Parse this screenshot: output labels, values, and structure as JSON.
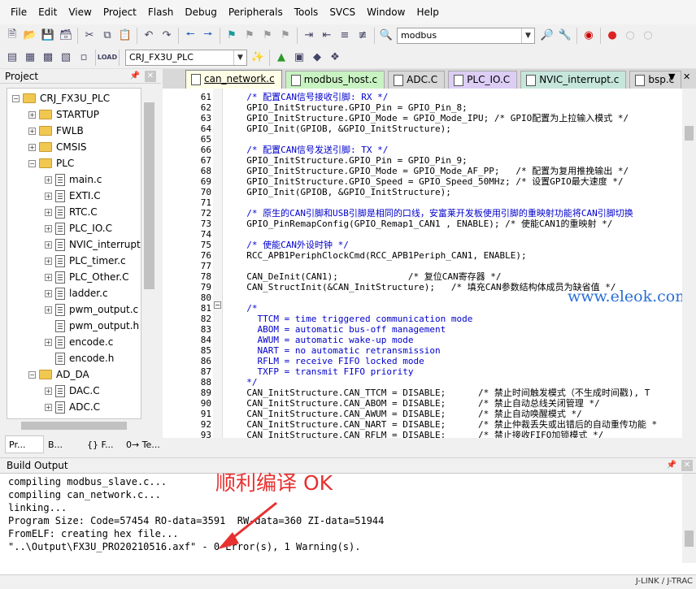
{
  "menu": [
    "File",
    "Edit",
    "View",
    "Project",
    "Flash",
    "Debug",
    "Peripherals",
    "Tools",
    "SVCS",
    "Window",
    "Help"
  ],
  "toolbar": {
    "find_value": "modbus",
    "target_value": "CRJ_FX3U_PLC"
  },
  "project": {
    "title": "Project",
    "tree": [
      {
        "label": "CRJ_FX3U_PLC",
        "type": "root",
        "level": 0,
        "expander": "minus"
      },
      {
        "label": "STARTUP",
        "type": "folder",
        "level": 1,
        "expander": "plus"
      },
      {
        "label": "FWLB",
        "type": "folder",
        "level": 1,
        "expander": "plus"
      },
      {
        "label": "CMSIS",
        "type": "folder",
        "level": 1,
        "expander": "plus"
      },
      {
        "label": "PLC",
        "type": "folder",
        "level": 1,
        "expander": "minus"
      },
      {
        "label": "main.c",
        "type": "file",
        "level": 2,
        "expander": "plus"
      },
      {
        "label": "EXTI.C",
        "type": "file",
        "level": 2,
        "expander": "plus"
      },
      {
        "label": "RTC.C",
        "type": "file",
        "level": 2,
        "expander": "plus"
      },
      {
        "label": "PLC_IO.C",
        "type": "file",
        "level": 2,
        "expander": "plus"
      },
      {
        "label": "NVIC_interrupt",
        "type": "file",
        "level": 2,
        "expander": "plus"
      },
      {
        "label": "PLC_timer.c",
        "type": "file",
        "level": 2,
        "expander": "plus"
      },
      {
        "label": "PLC_Other.C",
        "type": "file",
        "level": 2,
        "expander": "plus"
      },
      {
        "label": "ladder.c",
        "type": "file",
        "level": 2,
        "expander": "plus"
      },
      {
        "label": "pwm_output.c",
        "type": "file",
        "level": 2,
        "expander": "plus"
      },
      {
        "label": "pwm_output.h",
        "type": "file",
        "level": 2,
        "expander": "none"
      },
      {
        "label": "encode.c",
        "type": "file",
        "level": 2,
        "expander": "plus"
      },
      {
        "label": "encode.h",
        "type": "file",
        "level": 2,
        "expander": "none"
      },
      {
        "label": "AD_DA",
        "type": "folder",
        "level": 1,
        "expander": "minus"
      },
      {
        "label": "DAC.C",
        "type": "file",
        "level": 2,
        "expander": "plus"
      },
      {
        "label": "ADC.C",
        "type": "file",
        "level": 2,
        "expander": "plus"
      }
    ],
    "tabs": [
      "Pr...",
      "B...",
      "{} F...",
      "0→ Te..."
    ]
  },
  "editor": {
    "tabs": [
      {
        "label": "can_network.c",
        "color": "#ffffe8",
        "active": true
      },
      {
        "label": "modbus_host.c",
        "color": "#c9f2c3",
        "active": false
      },
      {
        "label": "ADC.C",
        "color": "#d8d8d8",
        "active": false
      },
      {
        "label": "PLC_IO.C",
        "color": "#dccdf5",
        "active": false
      },
      {
        "label": "NVIC_interrupt.c",
        "color": "#c6e6dc",
        "active": false
      },
      {
        "label": "bsp.c",
        "color": "#d8d8d8",
        "active": false
      }
    ],
    "lines": [
      {
        "n": "61",
        "t": "  /* 配置CAN信号接收引脚: RX */",
        "c": true
      },
      {
        "n": "62",
        "t": "  GPIO_InitStructure.GPIO_Pin = GPIO_Pin_8;",
        "c": false
      },
      {
        "n": "63",
        "t": "  GPIO_InitStructure.GPIO_Mode = GPIO_Mode_IPU; /* GPIO配置为上拉输入模式 */",
        "c": false
      },
      {
        "n": "64",
        "t": "  GPIO_Init(GPIOB, &GPIO_InitStructure);",
        "c": false
      },
      {
        "n": "65",
        "t": "",
        "c": false
      },
      {
        "n": "66",
        "t": "  /* 配置CAN信号发送引脚: TX */",
        "c": true
      },
      {
        "n": "67",
        "t": "  GPIO_InitStructure.GPIO_Pin = GPIO_Pin_9;",
        "c": false
      },
      {
        "n": "68",
        "t": "  GPIO_InitStructure.GPIO_Mode = GPIO_Mode_AF_PP;   /* 配置为复用推挽输出 */",
        "c": false
      },
      {
        "n": "69",
        "t": "  GPIO_InitStructure.GPIO_Speed = GPIO_Speed_50MHz; /* 设置GPIO最大速度 */",
        "c": false
      },
      {
        "n": "70",
        "t": "  GPIO_Init(GPIOB, &GPIO_InitStructure);",
        "c": false
      },
      {
        "n": "71",
        "t": "",
        "c": false
      },
      {
        "n": "72",
        "t": "  /* 原生的CAN引脚和USB引脚是相同的口线，安富莱开发板使用引脚的重映射功能将CAN引脚切换",
        "c": true
      },
      {
        "n": "73",
        "t": "  GPIO_PinRemapConfig(GPIO_Remap1_CAN1 , ENABLE); /* 使能CAN1的重映射 */",
        "c": false
      },
      {
        "n": "74",
        "t": "",
        "c": false
      },
      {
        "n": "75",
        "t": "  /* 使能CAN外设时钟 */",
        "c": true
      },
      {
        "n": "76",
        "t": "  RCC_APB1PeriphClockCmd(RCC_APB1Periph_CAN1, ENABLE);",
        "c": false
      },
      {
        "n": "77",
        "t": "",
        "c": false
      },
      {
        "n": "78",
        "t": "  CAN_DeInit(CAN1);             /* 复位CAN寄存器 */",
        "c": false
      },
      {
        "n": "79",
        "t": "  CAN_StructInit(&CAN_InitStructure);   /* 填充CAN参数结构体成员为缺省值 */",
        "c": false
      },
      {
        "n": "80",
        "t": "",
        "c": false
      },
      {
        "n": "81",
        "t": "  /*",
        "c": true
      },
      {
        "n": "82",
        "t": "    TTCM = time triggered communication mode",
        "c": true
      },
      {
        "n": "83",
        "t": "    ABOM = automatic bus-off management",
        "c": true
      },
      {
        "n": "84",
        "t": "    AWUM = automatic wake-up mode",
        "c": true
      },
      {
        "n": "85",
        "t": "    NART = no automatic retransmission",
        "c": true
      },
      {
        "n": "86",
        "t": "    RFLM = receive FIFO locked mode",
        "c": true
      },
      {
        "n": "87",
        "t": "    TXFP = transmit FIFO priority",
        "c": true
      },
      {
        "n": "88",
        "t": "  */",
        "c": true
      },
      {
        "n": "89",
        "t": "  CAN_InitStructure.CAN_TTCM = DISABLE;      /* 禁止时间触发模式（不生成时间戳), T",
        "c": false
      },
      {
        "n": "90",
        "t": "  CAN_InitStructure.CAN_ABOM = DISABLE;      /* 禁止自动总线关闭管理 */",
        "c": false
      },
      {
        "n": "91",
        "t": "  CAN_InitStructure.CAN_AWUM = DISABLE;      /* 禁止自动唤醒模式 */",
        "c": false
      },
      {
        "n": "92",
        "t": "  CAN_InitStructure.CAN_NART = DISABLE;      /* 禁止仲裁丢失或出错后的自动重传功能 *",
        "c": false
      },
      {
        "n": "93",
        "t": "  CAN_InitStructure.CAN_RFLM = DISABLE;      /* 禁止接收FIFO加锁模式 */",
        "c": false
      }
    ],
    "watermark": "www.eleok.com"
  },
  "build_output": {
    "title": "Build Output",
    "lines": [
      "compiling modbus_slave.c...",
      "compiling can_network.c...",
      "linking...",
      "Program Size: Code=57454 RO-data=3591  RW-data=360 ZI-data=51944",
      "FromELF: creating hex file...",
      "\"..\\Output\\FX3U_PRO20210516.axf\" - 0 Error(s), 1 Warning(s)."
    ],
    "annotation": "顺利编译 OK"
  },
  "status": {
    "debugger": "J-LINK / J-TRAC"
  }
}
